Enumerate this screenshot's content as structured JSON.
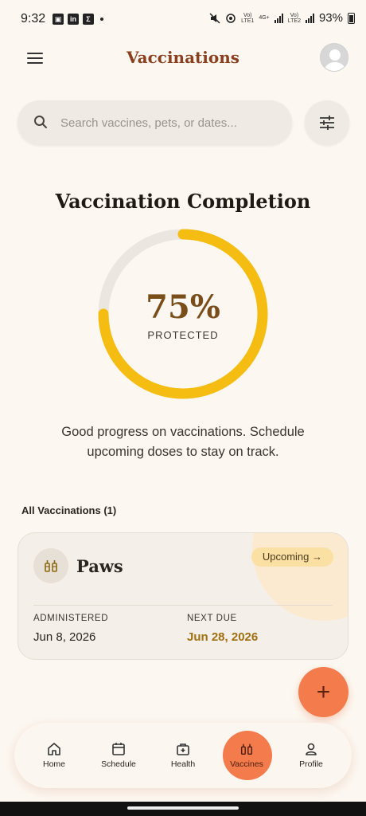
{
  "status_bar": {
    "time": "9:32",
    "battery": "93%",
    "sim1": "LTE1",
    "sim2": "LTE2",
    "net": "4G+"
  },
  "header": {
    "title": "Vaccinations"
  },
  "search": {
    "placeholder": "Search vaccines, pets, or dates..."
  },
  "completion": {
    "title": "Vaccination Completion",
    "percent": 75,
    "percent_label": "75%",
    "status_label": "PROTECTED",
    "message": "Good progress on vaccinations. Schedule upcoming doses to stay on track.",
    "ring_color": "#f5bd12",
    "track_color": "#ebe6df"
  },
  "list": {
    "header": "All Vaccinations (1)",
    "items": [
      {
        "pet": "Paws",
        "status": "Upcoming",
        "administered_label": "ADMINISTERED",
        "administered": "Jun 8, 2026",
        "next_due_label": "NEXT DUE",
        "next_due": "Jun 28, 2026"
      }
    ]
  },
  "fab": {
    "label": "+"
  },
  "nav": {
    "items": [
      {
        "label": "Home",
        "icon": "home-icon"
      },
      {
        "label": "Schedule",
        "icon": "calendar-icon"
      },
      {
        "label": "Health",
        "icon": "medical-kit-icon"
      },
      {
        "label": "Vaccines",
        "icon": "syringe-icon",
        "active": true
      },
      {
        "label": "Profile",
        "icon": "person-icon"
      }
    ]
  },
  "colors": {
    "accent": "#f47b4c",
    "brand": "#8a3f1e",
    "background": "#fcf8f1"
  }
}
